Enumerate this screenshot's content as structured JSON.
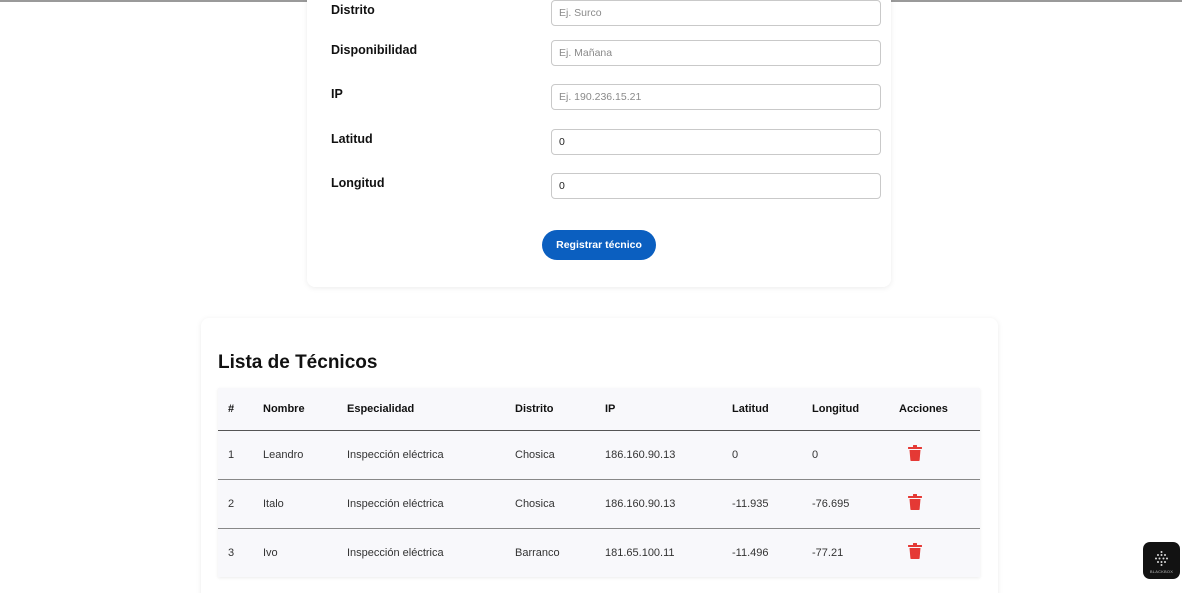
{
  "form": {
    "fields": [
      {
        "label": "Distrito",
        "value": "",
        "placeholder": "Ej. Surco"
      },
      {
        "label": "Disponibilidad",
        "value": "",
        "placeholder": "Ej. Mañana"
      },
      {
        "label": "IP",
        "value": "",
        "placeholder": "Ej. 190.236.15.21"
      },
      {
        "label": "Latitud",
        "value": "0",
        "placeholder": ""
      },
      {
        "label": "Longitud",
        "value": "0",
        "placeholder": ""
      }
    ],
    "submit_label": "Registrar técnico"
  },
  "list": {
    "title": "Lista de Técnicos",
    "headers": [
      "#",
      "Nombre",
      "Especialidad",
      "Distrito",
      "IP",
      "Latitud",
      "Longitud",
      "Acciones"
    ],
    "rows": [
      [
        "1",
        "Leandro",
        "Inspección eléctrica",
        "Chosica",
        "186.160.90.13",
        "0",
        "0"
      ],
      [
        "2",
        "Italo",
        "Inspección eléctrica",
        "Chosica",
        "186.160.90.13",
        "-11.935",
        "-76.695"
      ],
      [
        "3",
        "Ivo",
        "Inspección eléctrica",
        "Barranco",
        "181.65.100.11",
        "-11.496",
        "-77.21"
      ]
    ],
    "delete_icon": "trash-icon",
    "delete_color": "#e53935"
  },
  "widget": {
    "label": "BLACKBOX",
    "icon": "dots-grid-icon"
  },
  "colors": {
    "primary_button": "#0b5fc0",
    "danger": "#e53935"
  }
}
